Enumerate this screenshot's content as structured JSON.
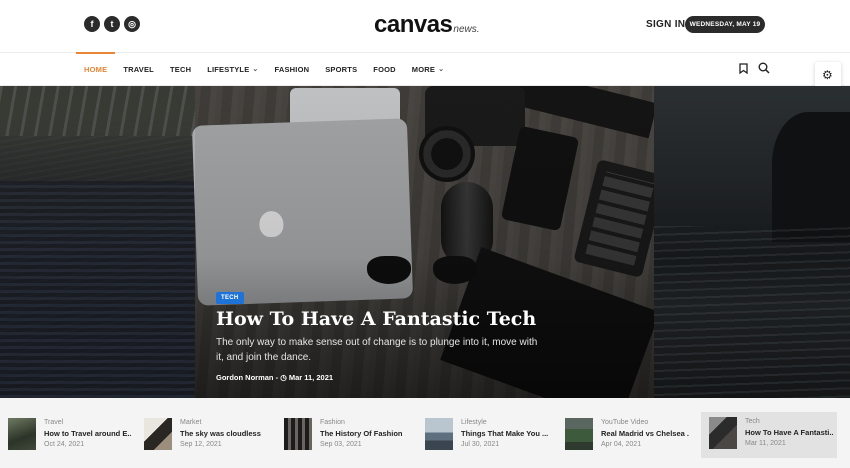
{
  "header": {
    "social": [
      {
        "icon": "facebook-icon",
        "glyph": "f"
      },
      {
        "icon": "twitter-icon",
        "glyph": "t"
      },
      {
        "icon": "instagram-icon",
        "glyph": "◎"
      }
    ],
    "logo_main": "canvas",
    "logo_sub": "news.",
    "signin_label": "SIGN IN",
    "date_label": "WEDNESDAY, MAY 19"
  },
  "nav": {
    "items": [
      {
        "label": "HOME",
        "active": true
      },
      {
        "label": "TRAVEL"
      },
      {
        "label": "TECH"
      },
      {
        "label": "LIFESTYLE",
        "dropdown": true
      },
      {
        "label": "FASHION"
      },
      {
        "label": "SPORTS"
      },
      {
        "label": "FOOD"
      },
      {
        "label": "MORE",
        "dropdown": true
      }
    ],
    "accent_color": "#e98535"
  },
  "hero": {
    "category": "TECH",
    "category_color": "#1e73d8",
    "title": "How To Have A Fantastic Tech",
    "excerpt": "The only way to make sense out of change is to plunge into it, move with it, and join the dance.",
    "author": "Gordon Norman",
    "date": "Mar 11, 2021"
  },
  "strip": {
    "cards": [
      {
        "category": "Travel",
        "title": "How to Travel around E...",
        "date": "Oct 24, 2021"
      },
      {
        "category": "Market",
        "title": "The sky was cloudless",
        "date": "Sep 12, 2021"
      },
      {
        "category": "Fashion",
        "title": "The History Of Fashion",
        "date": "Sep 03, 2021"
      },
      {
        "category": "Lifestyle",
        "title": "Things That Make You ...",
        "date": "Jul 30, 2021"
      },
      {
        "category": "YouTube Video",
        "title": "Real Madrid vs Chelsea ...",
        "date": "Apr 04, 2021"
      },
      {
        "category": "Tech",
        "title": "How To Have A Fantasti...",
        "date": "Mar 11, 2021",
        "active": true
      }
    ]
  }
}
